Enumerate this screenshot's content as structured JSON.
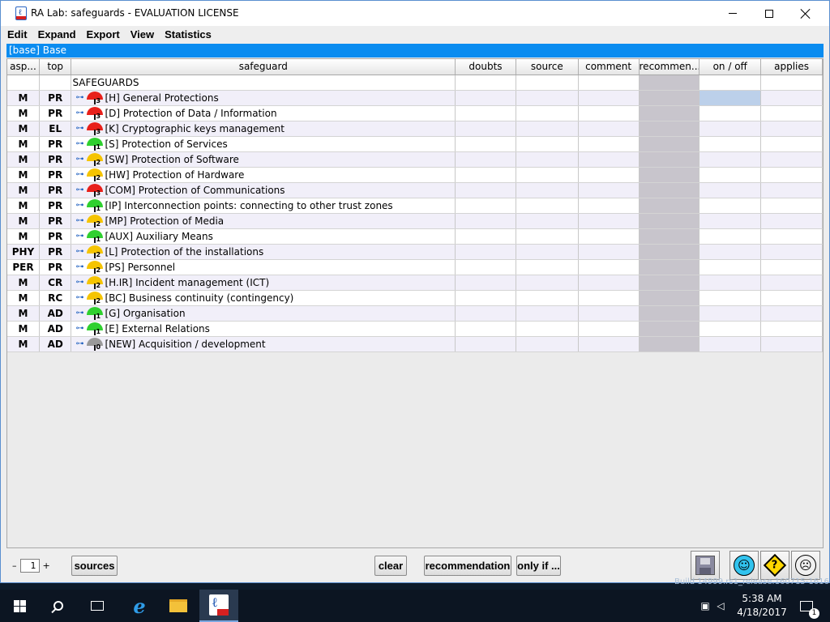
{
  "window": {
    "title": "RA Lab: safeguards - EVALUATION LICENSE",
    "icon": "pilar-app-icon"
  },
  "menu": [
    "Edit",
    "Expand",
    "Export",
    "View",
    "Statistics"
  ],
  "base_bar": "[base] Base",
  "table": {
    "headers": [
      "asp...",
      "top",
      "safeguard",
      "doubts",
      "source",
      "comment",
      "recommen...",
      "on / off",
      "applies"
    ],
    "root_label": "SAFEGUARDS",
    "rows": [
      {
        "asp": "M",
        "top": "PR",
        "label": "[H] General Protections",
        "level": "3",
        "color": "#e8201a"
      },
      {
        "asp": "M",
        "top": "PR",
        "label": "[D] Protection of Data / Information",
        "level": "3",
        "color": "#e8201a"
      },
      {
        "asp": "M",
        "top": "EL",
        "label": "[K] Cryptographic keys management",
        "level": "3",
        "color": "#e8201a"
      },
      {
        "asp": "M",
        "top": "PR",
        "label": "[S] Protection of Services",
        "level": "1",
        "color": "#2fd02f"
      },
      {
        "asp": "M",
        "top": "PR",
        "label": "[SW] Protection of Software",
        "level": "2",
        "color": "#f5c400"
      },
      {
        "asp": "M",
        "top": "PR",
        "label": "[HW] Protection of Hardware",
        "level": "2",
        "color": "#f5c400"
      },
      {
        "asp": "M",
        "top": "PR",
        "label": "[COM] Protection of Communications",
        "level": "3",
        "color": "#e8201a"
      },
      {
        "asp": "M",
        "top": "PR",
        "label": "[IP] Interconnection points: connecting to other trust zones",
        "level": "1",
        "color": "#2fd02f"
      },
      {
        "asp": "M",
        "top": "PR",
        "label": "[MP] Protection of Media",
        "level": "2",
        "color": "#f5c400"
      },
      {
        "asp": "M",
        "top": "PR",
        "label": "[AUX] Auxiliary Means",
        "level": "1",
        "color": "#2fd02f"
      },
      {
        "asp": "PHY",
        "top": "PR",
        "label": "[L] Protection of the installations",
        "level": "2",
        "color": "#f5c400"
      },
      {
        "asp": "PER",
        "top": "PR",
        "label": "[PS] Personnel",
        "level": "2",
        "color": "#f5c400"
      },
      {
        "asp": "M",
        "top": "CR",
        "label": "[H.IR] Incident management (ICT)",
        "level": "2",
        "color": "#f5c400"
      },
      {
        "asp": "M",
        "top": "RC",
        "label": "[BC] Business continuity (contingency)",
        "level": "2",
        "color": "#f5c400"
      },
      {
        "asp": "M",
        "top": "AD",
        "label": "[G] Organisation",
        "level": "1",
        "color": "#2fd02f"
      },
      {
        "asp": "M",
        "top": "AD",
        "label": "[E] External Relations",
        "level": "1",
        "color": "#2fd02f"
      },
      {
        "asp": "M",
        "top": "AD",
        "label": "[NEW] Acquisition / development",
        "level": "0",
        "color": "#9a9a9a"
      }
    ]
  },
  "bottom": {
    "minus": "–",
    "spinner_value": "1",
    "plus": "+",
    "sources": "sources",
    "clear": "clear",
    "recommendation": "recommendation",
    "only_if": "only if ...",
    "happy_glyph": "☺",
    "help_glyph": "?",
    "sad_glyph": "☹"
  },
  "build_text": "Build 14999.rs1_release.160715-1616",
  "taskbar": {
    "time": "5:38 AM",
    "date": "4/18/2017",
    "notification_count": "1"
  }
}
